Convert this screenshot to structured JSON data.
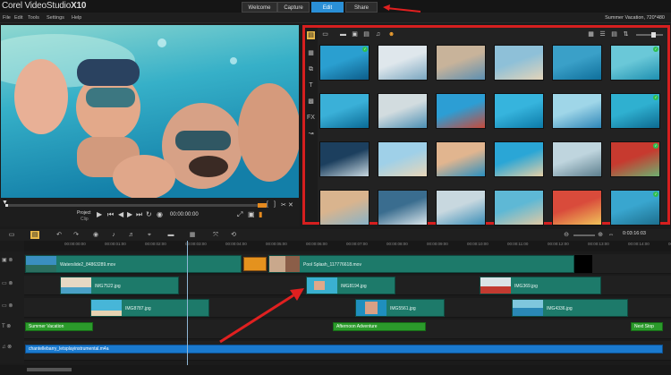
{
  "app": {
    "brand_prefix": "Corel",
    "brand_name": "VideoStudio",
    "brand_suffix": "X10"
  },
  "nav_tabs": [
    {
      "label": "Welcome",
      "active": false
    },
    {
      "label": "Capture",
      "active": false
    },
    {
      "label": "Edit",
      "active": true
    },
    {
      "label": "Share",
      "active": false
    }
  ],
  "menu": [
    "File",
    "Edit",
    "Tools",
    "Settings",
    "Help"
  ],
  "project_info": "Summer Vacation, 720*480",
  "player": {
    "mode_label": "Project",
    "mode_sub": "Clip",
    "timecode": "00:00:00:00"
  },
  "library": {
    "sidebar_icons": [
      "media-icon",
      "instant-project-icon",
      "transition-icon",
      "title-icon",
      "graphics-icon",
      "filter-icon",
      "path-icon"
    ],
    "toolbar_icons": [
      "folder-icon",
      "video-icon",
      "photo-icon",
      "audio-icon",
      "face-icon"
    ],
    "view_icons": [
      "list-view-icon",
      "thumbnail-view-icon",
      "sort-icon",
      "zoom-slider"
    ],
    "thumbnails": [
      {
        "tone": [
          "#2a9fd0",
          "#0d5d8a"
        ],
        "checked": true
      },
      {
        "tone": [
          "#dfe7ec",
          "#7aa6c0"
        ],
        "checked": false
      },
      {
        "tone": [
          "#c8b39a",
          "#5c8fb1"
        ],
        "checked": false
      },
      {
        "tone": [
          "#8ec0d8",
          "#e4d4b9"
        ],
        "checked": false
      },
      {
        "tone": [
          "#3aa0c8",
          "#0f6f9b"
        ],
        "checked": false
      },
      {
        "tone": [
          "#6ac8d8",
          "#1e8fb0"
        ],
        "checked": true
      },
      {
        "tone": [
          "#3ab0d8",
          "#0a6a95"
        ],
        "checked": false
      },
      {
        "tone": [
          "#d2dcdf",
          "#4b8fb4"
        ],
        "checked": false
      },
      {
        "tone": [
          "#2c9ed4",
          "#c84a3a"
        ],
        "checked": false
      },
      {
        "tone": [
          "#36b4dd",
          "#0c7aa8"
        ],
        "checked": false
      },
      {
        "tone": [
          "#9fd6e8",
          "#2e86b8"
        ],
        "checked": false
      },
      {
        "tone": [
          "#2fb0d0",
          "#0d6a90"
        ],
        "checked": true
      },
      {
        "tone": [
          "#1c3f5e",
          "#c8d8e0"
        ],
        "checked": false
      },
      {
        "tone": [
          "#9fd0e8",
          "#e8d6b8"
        ],
        "checked": false
      },
      {
        "tone": [
          "#e1b58f",
          "#2b8fbf"
        ],
        "checked": false
      },
      {
        "tone": [
          "#2aa6d6",
          "#e5cfa6"
        ],
        "checked": false
      },
      {
        "tone": [
          "#bfd5de",
          "#5d7f8e"
        ],
        "checked": false
      },
      {
        "tone": [
          "#c73a2f",
          "#6fb070"
        ],
        "checked": true
      },
      {
        "tone": [
          "#d9b48e",
          "#8ab3c7"
        ],
        "checked": false
      },
      {
        "tone": [
          "#3a6d8f",
          "#d8e4ea"
        ],
        "checked": false
      },
      {
        "tone": [
          "#c8d8df",
          "#3c8fb8"
        ],
        "checked": false
      },
      {
        "tone": [
          "#5eb8d5",
          "#e0c9a4"
        ],
        "checked": false
      },
      {
        "tone": [
          "#d94b3b",
          "#f0c25a"
        ],
        "checked": false
      },
      {
        "tone": [
          "#39a6cf",
          "#1d6f8e"
        ],
        "checked": true
      }
    ]
  },
  "timeline": {
    "toolbar_icons": [
      "storyboard-view-icon",
      "timeline-view-icon",
      "undo-icon",
      "redo-icon",
      "record-icon",
      "sound-mixer-icon",
      "auto-music-icon",
      "motion-tracking-icon",
      "subtitle-icon",
      "multicam-icon"
    ],
    "project_duration": "0:03:16:03",
    "ruler_ticks": [
      "00:00:00:00",
      "00:00:01:00",
      "00:00:02:00",
      "00:00:03:00",
      "00:00:04:00",
      "00:00:05:00",
      "00:00:06:00",
      "00:00:07:00",
      "00:00:08:00",
      "00:00:09:00",
      "00:00:10:00",
      "00:00:11:00",
      "00:00:12:00",
      "00:00:13:00",
      "00:00:14:00",
      "00:00:15:00"
    ],
    "video_track": [
      {
        "label": "Waterslide2_84863289.mov"
      },
      {
        "label": "Pool Splash_117776618.mov"
      }
    ],
    "overlay1": [
      {
        "label": "IMG7522.jpg"
      },
      {
        "label": "IMG8194.jpg"
      },
      {
        "label": "IMG369.jpg"
      }
    ],
    "overlay2": [
      {
        "label": "IMG8787.jpg"
      },
      {
        "label": "IMG5561.jpg"
      },
      {
        "label": "IMG4336.jpg"
      }
    ],
    "titles": [
      {
        "label": "Summer Vacation"
      },
      {
        "label": "Afternoon Adventure"
      },
      {
        "label": "Next Stop"
      }
    ],
    "music": [
      {
        "label": "chantellebarry_letsplayinstrumental.m4a"
      }
    ]
  },
  "colors": {
    "accent": "#2a8fd6",
    "highlight_border": "#d61f1f",
    "annotation_arrow": "#e02020",
    "video_clip": "#1d7a6a",
    "title_clip": "#2b9a2b",
    "audio_clip": "#1a7acf"
  }
}
